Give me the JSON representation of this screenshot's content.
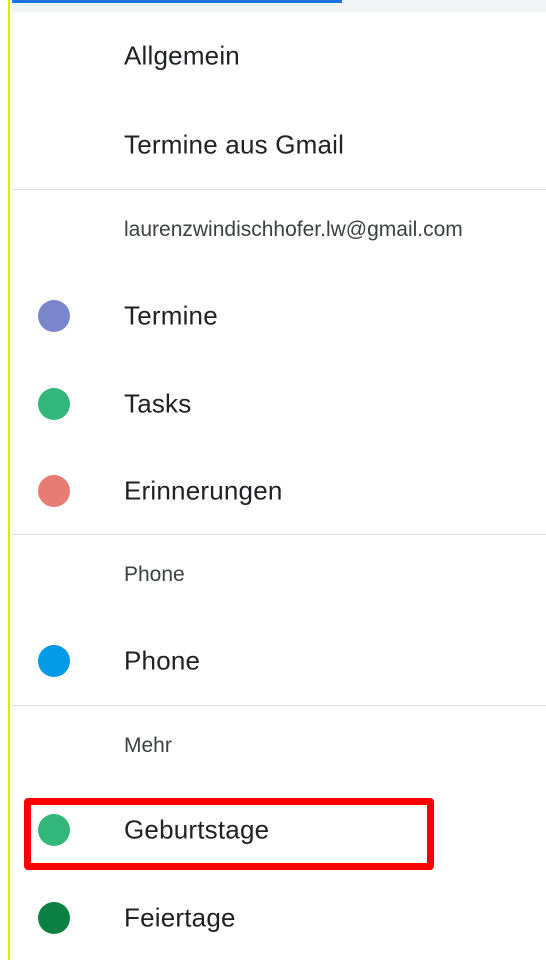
{
  "menu": {
    "general": "Allgemein",
    "gmail_events": "Termine aus Gmail"
  },
  "account_section": {
    "header": "laurenzwindischhofer.lw@gmail.com",
    "calendars": [
      {
        "label": "Termine",
        "color": "#7986cb"
      },
      {
        "label": "Tasks",
        "color": "#33b679"
      },
      {
        "label": "Erinnerungen",
        "color": "#e67c73"
      }
    ]
  },
  "phone_section": {
    "header": "Phone",
    "calendars": [
      {
        "label": "Phone",
        "color": "#039be5"
      }
    ]
  },
  "more_section": {
    "header": "Mehr",
    "calendars": [
      {
        "label": "Geburtstage",
        "color": "#33b679"
      },
      {
        "label": "Feiertage",
        "color": "#0b8043"
      }
    ]
  },
  "annotation": {
    "highlight_color": "#ff0000",
    "highlighted_item": "Geburtstage"
  }
}
